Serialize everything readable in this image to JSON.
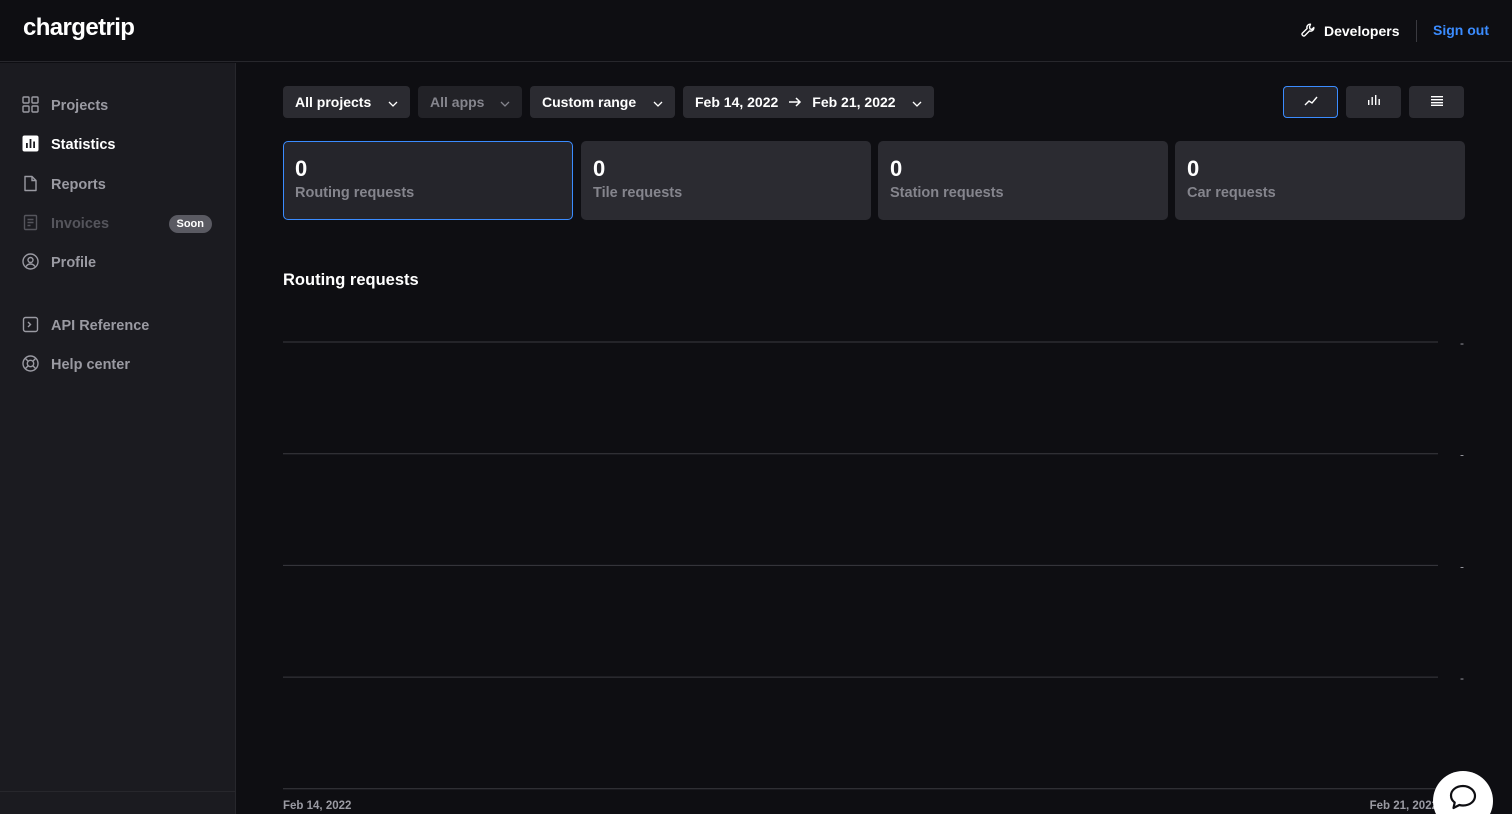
{
  "header": {
    "logo": "chargetrip",
    "developers_label": "Developers",
    "signout_label": "Sign out"
  },
  "sidebar": {
    "items": [
      {
        "label": "Projects",
        "icon": "grid-icon"
      },
      {
        "label": "Statistics",
        "icon": "bar-chart-icon"
      },
      {
        "label": "Reports",
        "icon": "document-icon"
      },
      {
        "label": "Invoices",
        "icon": "receipt-icon",
        "badge": "Soon"
      },
      {
        "label": "Profile",
        "icon": "user-circle-icon"
      },
      {
        "label": "API Reference",
        "icon": "terminal-icon"
      },
      {
        "label": "Help center",
        "icon": "lifebuoy-icon"
      }
    ]
  },
  "filters": {
    "projects": "All projects",
    "apps": "All apps",
    "range": "Custom range",
    "date_from": "Feb 14, 2022",
    "date_to": "Feb 21, 2022"
  },
  "view_toggle": [
    "line-chart-icon",
    "bar-chart-icon",
    "list-icon"
  ],
  "cards": [
    {
      "value": "0",
      "label": "Routing requests"
    },
    {
      "value": "0",
      "label": "Tile requests"
    },
    {
      "value": "0",
      "label": "Station requests"
    },
    {
      "value": "0",
      "label": "Car requests"
    }
  ],
  "chart": {
    "title": "Routing requests"
  },
  "chart_data": {
    "type": "line",
    "title": "Routing requests",
    "x": [
      "Feb 14, 2022",
      "Feb 21, 2022"
    ],
    "x_tick_labels": [
      "Feb 14, 2022",
      "Feb 21, 2022"
    ],
    "y_tick_labels": [
      "-",
      "-",
      "-",
      "-"
    ],
    "series": [],
    "grid": true
  },
  "colors": {
    "accent": "#3b8cff",
    "background": "#0e0e12",
    "sidebar": "#1b1b20",
    "card": "#2b2b31"
  }
}
